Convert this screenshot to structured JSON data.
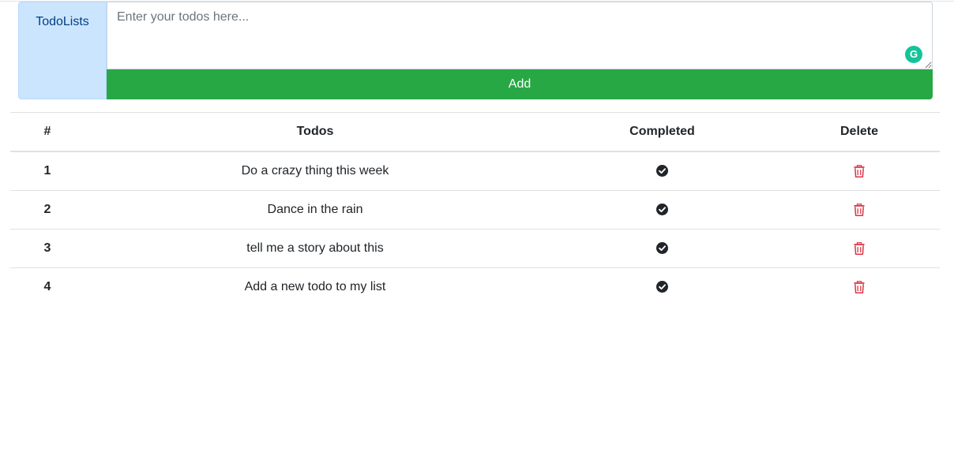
{
  "header": {
    "brand": "TodoLists",
    "input_placeholder": "Enter your todos here...",
    "input_value": "",
    "add_label": "Add",
    "grammarly_glyph": "G"
  },
  "table": {
    "columns": [
      "#",
      "Todos",
      "Completed",
      "Delete"
    ],
    "rows": [
      {
        "num": "1",
        "text": "Do a crazy thing this week",
        "completed": true
      },
      {
        "num": "2",
        "text": "Dance in the rain",
        "completed": true
      },
      {
        "num": "3",
        "text": "tell me a story about this",
        "completed": true
      },
      {
        "num": "4",
        "text": "Add a new todo to my list",
        "completed": true
      }
    ]
  },
  "icons": {
    "completed": "check-circle-icon",
    "delete": "trash-icon",
    "grammarly": "grammarly-icon"
  },
  "colors": {
    "brand_bg": "#cce5ff",
    "brand_text": "#004085",
    "add_button": "#28a745",
    "delete_icon": "#dc3545",
    "grammarly": "#15c39a"
  }
}
